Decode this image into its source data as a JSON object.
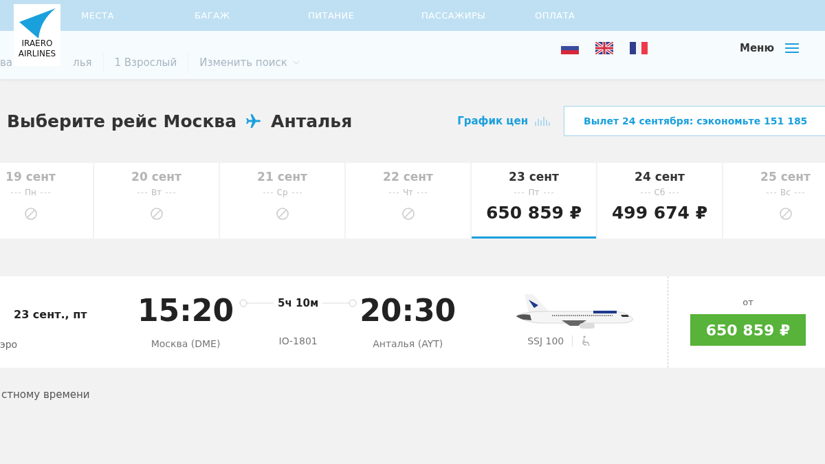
{
  "nav_tabs": [
    {
      "label": "МЕСТА"
    },
    {
      "label": "БАГАЖ"
    },
    {
      "label": "ПИТАНИЕ"
    },
    {
      "label": "ПАССАЖИРЫ"
    },
    {
      "label": "ОПЛАТА"
    }
  ],
  "search_summary": [
    "ва",
    "лья",
    "1 Взрослый",
    "Изменить поиск"
  ],
  "logo": {
    "line1": "IRAERO",
    "line2": "AIRLINES"
  },
  "languages": [
    {
      "kind": "ru"
    },
    {
      "kind": "gb"
    },
    {
      "kind": "fr"
    }
  ],
  "menu": {
    "label": "Меню"
  },
  "heading": {
    "from": "Выберите рейс Москва",
    "to": "Анталья"
  },
  "price_chart_link": "График цен",
  "promo": "Вылет 24 сентября: сэкономьте 151 185",
  "dates": [
    {
      "date": "19 сент",
      "weekday": "Пн",
      "available": false,
      "selected": false
    },
    {
      "date": "20 сент",
      "weekday": "Вт",
      "available": false,
      "selected": false
    },
    {
      "date": "21 сент",
      "weekday": "Ср",
      "available": false,
      "selected": false
    },
    {
      "date": "22 сент",
      "weekday": "Чт",
      "available": false,
      "selected": false
    },
    {
      "date": "23 сент",
      "weekday": "Пт",
      "available": true,
      "price": "650 859 ₽",
      "selected": true
    },
    {
      "date": "24 сент",
      "weekday": "Сб",
      "available": true,
      "price": "499 674 ₽",
      "selected": false
    },
    {
      "date": "25 сент",
      "weekday": "Вс",
      "available": false,
      "selected": false
    }
  ],
  "flight": {
    "date": "23 сент., пт",
    "airline": "эро",
    "departure_time": "15:20",
    "departure_airport": "Москва (DME)",
    "duration": "5ч 10м",
    "flight_number": "IO-1801",
    "arrival_time": "20:30",
    "arrival_airport": "Анталья (AYT)",
    "aircraft": "SSJ 100",
    "price_label": "от",
    "price": "650 859 ₽"
  },
  "footnote": "стному времени"
}
